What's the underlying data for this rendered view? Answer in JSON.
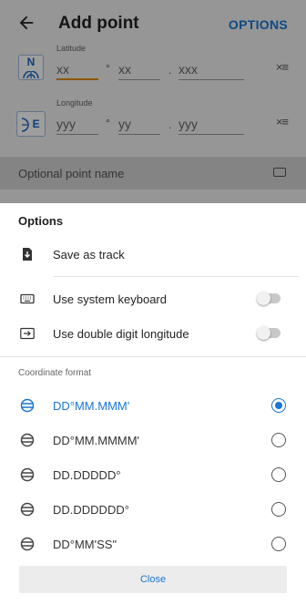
{
  "header": {
    "title": "Add point",
    "options_label": "OPTIONS"
  },
  "latitude": {
    "label": "Latitude",
    "hemisphere": "N",
    "degrees_placeholder": "xx",
    "minutes_placeholder": "xx",
    "decimal_placeholder": "xxx",
    "degree_sep": "°",
    "decimal_sep": ".",
    "clear_label": "×≡"
  },
  "longitude": {
    "label": "Longitude",
    "hemisphere": "E",
    "degrees_placeholder": "yyy",
    "minutes_placeholder": "yy",
    "decimal_placeholder": "yyy",
    "degree_sep": "°",
    "decimal_sep": ".",
    "clear_label": "×≡"
  },
  "name_field": {
    "placeholder": "Optional point name"
  },
  "sheet": {
    "title": "Options",
    "items": [
      {
        "label": "Save as track",
        "icon": "save-track-icon"
      },
      {
        "label": "Use system keyboard",
        "icon": "keyboard-icon",
        "toggle": false
      },
      {
        "label": "Use double digit longitude",
        "icon": "arrow-box-icon",
        "toggle": false
      }
    ],
    "coordinate_format_label": "Coordinate format",
    "formats": [
      {
        "label": "DD°MM.MMM'",
        "selected": true
      },
      {
        "label": "DD°MM.MMMM'",
        "selected": false
      },
      {
        "label": "DD.DDDDD°",
        "selected": false
      },
      {
        "label": "DD.DDDDDD°",
        "selected": false
      },
      {
        "label": "DD°MM'SS\"",
        "selected": false
      }
    ],
    "close_label": "Close"
  },
  "colors": {
    "accent": "#1976d2",
    "focus_underline": "#e68a00"
  }
}
